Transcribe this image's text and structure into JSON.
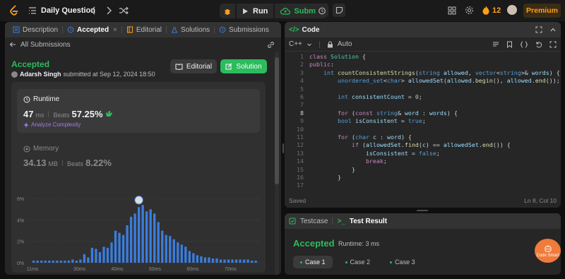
{
  "topbar": {
    "title": "Daily Question",
    "run_label": "Run",
    "submit_label": "Submit",
    "streak_count": "12",
    "premium_label": "Premium"
  },
  "left_tabs": [
    {
      "label": "Description",
      "icon": "description-icon"
    },
    {
      "label": "Accepted",
      "icon": "history-icon",
      "close": "×"
    },
    {
      "label": "Editorial",
      "icon": "book-icon"
    },
    {
      "label": "Solutions",
      "icon": "flask-icon"
    },
    {
      "label": "Submissions",
      "icon": "history-icon"
    }
  ],
  "submission": {
    "back_label": "All Submissions",
    "status": "Accepted",
    "user": "Adarsh Singh",
    "submitted_text": "submitted at Sep 12, 2024 18:50",
    "editorial_label": "Editorial",
    "solution_label": "Solution",
    "runtime_label": "Runtime",
    "runtime_value": "47",
    "runtime_unit": "ms",
    "beats_label": "Beats",
    "runtime_beats": "57.25%",
    "analyze_label": "Analyze Complexity",
    "memory_label": "Memory",
    "memory_value": "34.13",
    "memory_unit": "MB",
    "memory_beats": "8.22%"
  },
  "chart_data": {
    "type": "bar",
    "x_ticks": [
      "11ms",
      "30ms",
      "40ms",
      "50ms",
      "60ms",
      "70ms"
    ],
    "y_ticks": [
      "0%",
      "2%",
      "4%",
      "6%"
    ],
    "ylim": [
      0,
      7
    ],
    "highlight_index": 27,
    "values": [
      0.2,
      0.2,
      0.2,
      0.2,
      0.2,
      0.2,
      0.2,
      0.2,
      0.2,
      0.2,
      0.3,
      0.2,
      0.3,
      0.8,
      0.5,
      1.4,
      1.3,
      1.0,
      1.5,
      1.4,
      1.9,
      3.0,
      2.8,
      2.6,
      3.5,
      4.3,
      4.6,
      5.2,
      5.4,
      4.8,
      5.0,
      4.6,
      3.8,
      3.0,
      2.6,
      2.5,
      2.2,
      1.9,
      1.7,
      1.5,
      1.1,
      0.9,
      0.7,
      0.6,
      0.5,
      0.5,
      0.4,
      0.4,
      0.3,
      0.3,
      0.3,
      0.3,
      0.3,
      0.3,
      0.3,
      0.3,
      0.2,
      0.2
    ],
    "bar_color": "#3b7ddd"
  },
  "code_panel": {
    "title": "Code",
    "language": "C++",
    "mode": "Auto",
    "status": "Saved",
    "cursor": "Ln 8, Col 10",
    "current_line": 8,
    "lines": [
      "class Solution {",
      "public:",
      "    int countConsistentStrings(string allowed, vector<string>& words) {",
      "        unordered_set<char> allowedSet(allowed.begin(), allowed.end());",
      "",
      "        int consistentCount = 0;",
      "",
      "        for (const string& word : words) {",
      "        bool isConsistent = true;",
      "",
      "        for (char c : word) {",
      "            if (allowedSet.find(c) == allowedSet.end()) {",
      "                isConsistent = false;",
      "                break;",
      "            }",
      "        }",
      ""
    ]
  },
  "testcase_panel": {
    "testcase_label": "Testcase",
    "result_label": "Test Result",
    "status": "Accepted",
    "runtime": "Runtime: 3 ms",
    "cases": [
      "Case 1",
      "Case 2",
      "Case 3"
    ]
  },
  "code_smart_label": "Code Smart",
  "colors": {
    "accent_green": "#2cbb5d",
    "accent_orange": "#ffa116",
    "purple": "#a779e9"
  }
}
